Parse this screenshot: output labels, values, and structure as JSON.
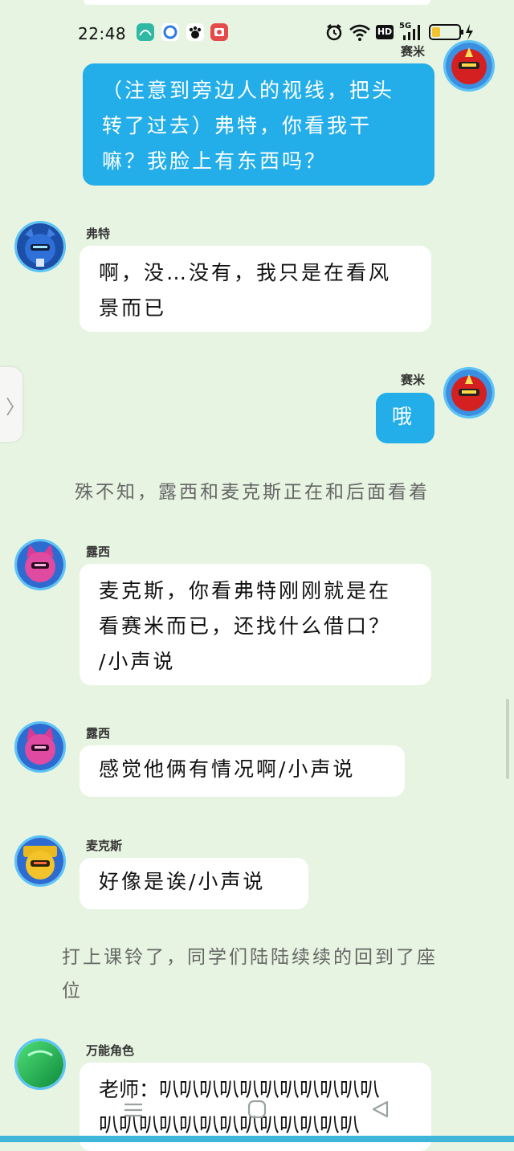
{
  "status_bar": {
    "time": "22:48",
    "network_label": "5G",
    "hd_label": "HD",
    "app_icons": [
      "green-app-icon",
      "browser-icon",
      "paw-app-icon",
      "red-app-icon"
    ],
    "right_icons": [
      "alarm-icon",
      "wifi-icon",
      "hd-icon",
      "signal-icon",
      "battery-icon",
      "charging-icon"
    ]
  },
  "messages": [
    {
      "sender": "赛米",
      "side": "right",
      "avatar": "red-robot",
      "lines": [
        "（注意到旁边人的视线，把头",
        "转了过去）弗特，你看我干",
        "嘛？我脸上有东西吗？"
      ]
    },
    {
      "sender": "弗特",
      "side": "left",
      "avatar": "blue-robot",
      "lines": [
        "啊，没…没有，我只是在看风",
        "景而已"
      ]
    },
    {
      "sender": "赛米",
      "side": "right",
      "avatar": "red-robot",
      "lines": [
        "哦"
      ]
    },
    {
      "narration": "殊不知，露西和麦克斯正在和后面看着"
    },
    {
      "sender": "露西",
      "side": "left",
      "avatar": "pink-robot",
      "lines": [
        "麦克斯，你看弗特刚刚就是在",
        "看赛米而已，还找什么借口？",
        "/小声说"
      ]
    },
    {
      "sender": "露西",
      "side": "left",
      "avatar": "pink-robot",
      "lines": [
        "感觉他俩有情况啊/小声说"
      ]
    },
    {
      "sender": "麦克斯",
      "side": "left",
      "avatar": "yellow-robot",
      "lines": [
        "好像是诶/小声说"
      ]
    },
    {
      "narration": "打上课铃了，同学们陆陆续续的回到了座位"
    },
    {
      "sender": "万能角色",
      "side": "left",
      "avatar": "green-circle",
      "lines": [
        "老师：叭叭叭叭叭叭叭叭叭叭叭",
        "叭叭叭叭叭叭叭叭叭叭叭叭叭"
      ]
    }
  ],
  "colors": {
    "background": "#e7f4e1",
    "right_bubble": "#23aee9",
    "left_bubble": "#ffffff",
    "avatar_ring": "#5bc3f5",
    "battery_fill": "#f2c230"
  },
  "navigation": {
    "icons": [
      "menu-icon",
      "home-icon",
      "back-icon"
    ]
  },
  "side_tab": {
    "icon": "chevron-right-icon",
    "glyph": "〉"
  }
}
